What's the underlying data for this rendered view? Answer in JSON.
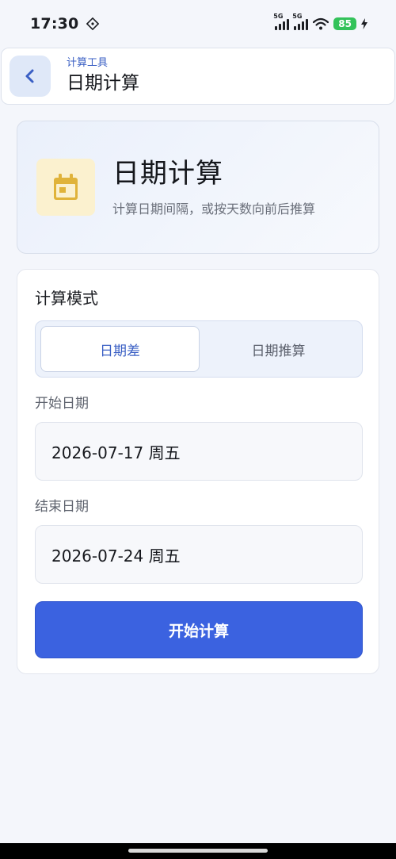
{
  "status_bar": {
    "time": "17:30",
    "network_1": "5G",
    "network_2": "5G",
    "battery": "85"
  },
  "header": {
    "subtitle": "计算工具",
    "title": "日期计算",
    "back_icon": "chevron-left-icon"
  },
  "hero": {
    "icon": "calendar-icon",
    "title": "日期计算",
    "description": "计算日期间隔，或按天数向前后推算"
  },
  "mode": {
    "section_title": "计算模式",
    "options": [
      "日期差",
      "日期推算"
    ],
    "selected": "日期差"
  },
  "start_date": {
    "label": "开始日期",
    "value": "2026-07-17  周五"
  },
  "end_date": {
    "label": "结束日期",
    "value": "2026-07-24  周五"
  },
  "action": {
    "label": "开始计算"
  },
  "colors": {
    "accent": "#3b62e0",
    "icon_bg": "#fbf1cf",
    "icon_fg": "#e0b33a",
    "battery": "#33c25a"
  }
}
